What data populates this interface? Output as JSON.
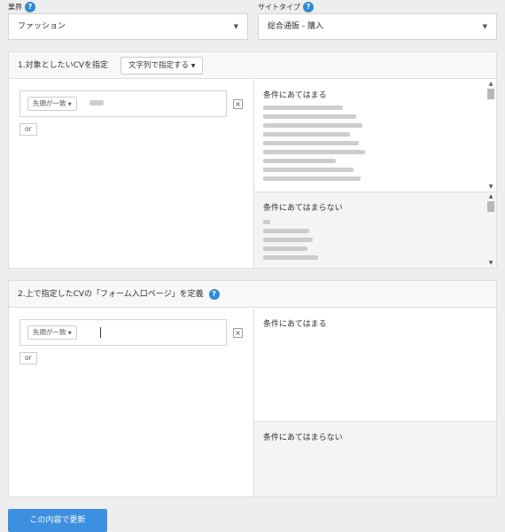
{
  "industry": {
    "label": "業界",
    "value": "ファッション"
  },
  "site_type": {
    "label": "サイトタイプ",
    "value": "総合通販 - 購入"
  },
  "section1": {
    "title": "1.対象としたいCVを指定",
    "mode_button": "文字列で指定する",
    "match_select": "先頭が一致",
    "or_label": "or",
    "match_title": "条件にあてはまる",
    "nomatch_title": "条件にあてはまらない"
  },
  "section2": {
    "title": "2.上で指定したCVの「フォーム入口ページ」を定義",
    "match_select": "先頭が一致",
    "or_label": "or",
    "match_title": "条件にあてはまる",
    "nomatch_title": "条件にあてはまらない"
  },
  "submit_label": "この内容で更新",
  "colors": {
    "accent": "#3d8fe0",
    "help": "#2f8ad6"
  },
  "icons": {
    "help": "?",
    "dropdown": "▼",
    "close": "×"
  }
}
